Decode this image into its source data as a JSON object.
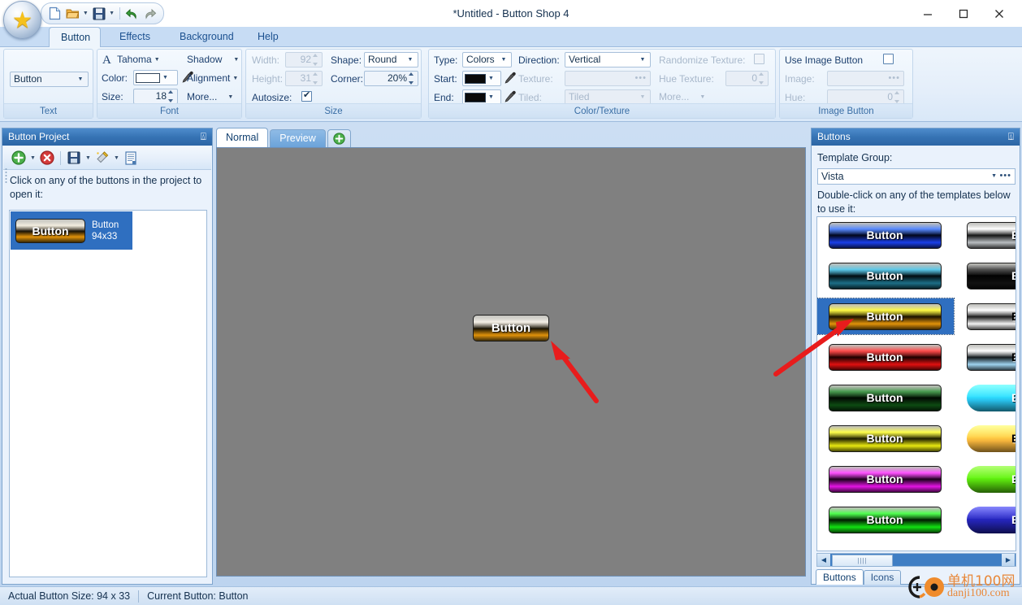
{
  "window": {
    "title": "*Untitled - Button Shop 4",
    "minimize_label": "Minimize",
    "maximize_label": "Maximize",
    "close_label": "Close"
  },
  "quick_access": {
    "items": [
      {
        "icon": "new-document-icon",
        "label": "New"
      },
      {
        "icon": "open-folder-icon",
        "label": "Open"
      },
      {
        "icon": "save-disk-icon",
        "label": "Save"
      },
      {
        "icon": "undo-icon",
        "label": "Undo"
      },
      {
        "icon": "redo-icon",
        "label": "Redo"
      }
    ]
  },
  "app_orb": {
    "icon": "star-icon"
  },
  "ribbon": {
    "tabs": [
      {
        "label": "Button",
        "active": true
      },
      {
        "label": "Effects",
        "active": false
      },
      {
        "label": "Background",
        "active": false
      },
      {
        "label": "Help",
        "active": false
      }
    ],
    "groups": {
      "text": {
        "title": "Text",
        "value": "Button"
      },
      "font": {
        "title": "Font",
        "font_name": "Tahoma",
        "color_label": "Color:",
        "size_label": "Size:",
        "size_value": "18",
        "shadow_label": "Shadow",
        "alignment_label": "Alignment",
        "more_label": "More...",
        "color_value": "#ffffff"
      },
      "size": {
        "title": "Size",
        "width_label": "Width:",
        "width_value": "92",
        "height_label": "Height:",
        "height_value": "31",
        "autosize_label": "Autosize:",
        "autosize_checked": true,
        "shape_label": "Shape:",
        "shape_value": "Round",
        "corner_label": "Corner:",
        "corner_value": "20%"
      },
      "color_texture": {
        "title": "Color/Texture",
        "type_label": "Type:",
        "type_value": "Colors",
        "start_label": "Start:",
        "start_color": "#0a0a0a",
        "end_label": "End:",
        "end_color": "#0a0a0a",
        "direction_label": "Direction:",
        "direction_value": "Vertical",
        "texture_label": "Texture:",
        "texture_value": "",
        "tiled_label": "Tiled:",
        "tiled_value": "Tiled",
        "randomize_label": "Randomize Texture:",
        "randomize_checked": false,
        "hue_texture_label": "Hue Texture:",
        "hue_texture_value": "0",
        "more_label": "More..."
      },
      "image_button": {
        "title": "Image Button",
        "use_label": "Use Image Button",
        "use_checked": false,
        "image_label": "Image:",
        "image_value": "",
        "hue_label": "Hue:",
        "hue_value": "0"
      }
    }
  },
  "left_panel": {
    "title": "Button Project",
    "pin_icon": "pin-icon",
    "toolbar": [
      {
        "icon": "add-button-icon",
        "label": "Add Button",
        "caret": true
      },
      {
        "icon": "delete-button-icon",
        "label": "Delete Button",
        "caret": false
      },
      {
        "icon": "save-project-icon",
        "label": "Save Project",
        "caret": true
      },
      {
        "icon": "wand-icon",
        "label": "Tools",
        "caret": true
      },
      {
        "icon": "list-icon",
        "label": "Properties",
        "caret": false
      }
    ],
    "hint": "Click on any of the buttons in the project to open it:",
    "items": [
      {
        "caption_line1": "Button",
        "caption_line2": "94x33",
        "text": "Button",
        "selected": true
      }
    ]
  },
  "center": {
    "tabs": [
      {
        "label": "Normal",
        "active": true
      },
      {
        "label": "Preview",
        "active": false
      },
      {
        "label": "",
        "icon": "add-tab-icon",
        "active": false
      }
    ],
    "canvas_color": "#808080",
    "button": {
      "text": "Button",
      "width": 94,
      "height": 33
    }
  },
  "right_panel": {
    "title": "Buttons",
    "pin_icon": "pin-icon",
    "template_group_label": "Template Group:",
    "template_group_value": "Vista",
    "hint": "Double-click on any of the templates below to use it:",
    "templates": [
      {
        "text": "Button",
        "accent": "#1a3fe8",
        "shape": "round",
        "dark_text": false,
        "selected": false
      },
      {
        "text": "Butt",
        "accent": "#b9bdc1",
        "shape": "round",
        "dark_text": false,
        "selected": false
      },
      {
        "text": "Button",
        "accent": "#1c6e86",
        "shape": "round",
        "dark_text": false,
        "selected": false
      },
      {
        "text": "Butt",
        "accent": "#111111",
        "shape": "round",
        "dark_text": false,
        "selected": false
      },
      {
        "text": "Button",
        "accent": "#e0920a",
        "shape": "round",
        "dark_text": false,
        "selected": true
      },
      {
        "text": "Butt",
        "accent": "#f2f2f2",
        "shape": "round",
        "dark_text": true,
        "selected": false
      },
      {
        "text": "Button",
        "accent": "#e01010",
        "shape": "round",
        "dark_text": false,
        "selected": false
      },
      {
        "text": "Butt",
        "accent": "#9ed2ee",
        "shape": "round",
        "dark_text": true,
        "selected": false
      },
      {
        "text": "Button",
        "accent": "#0d4a12",
        "shape": "round",
        "dark_text": false,
        "selected": false
      },
      {
        "text": "Butt",
        "accent": "#29c3ee",
        "shape": "pill",
        "dark_text": false,
        "selected": false
      },
      {
        "text": "Button",
        "accent": "#e8e810",
        "shape": "round",
        "dark_text": false,
        "selected": false
      },
      {
        "text": "Butt",
        "accent": "#f5b43c",
        "shape": "pill",
        "dark_text": true,
        "selected": false
      },
      {
        "text": "Button",
        "accent": "#e214e2",
        "shape": "round",
        "dark_text": false,
        "selected": false
      },
      {
        "text": "Butt",
        "accent": "#55d40d",
        "shape": "pill",
        "dark_text": false,
        "selected": false
      },
      {
        "text": "Button",
        "accent": "#12e012",
        "shape": "round",
        "dark_text": false,
        "selected": false
      },
      {
        "text": "Butt",
        "accent": "#2222aa",
        "shape": "pill",
        "dark_text": false,
        "selected": false
      }
    ],
    "scroll": {
      "left_arrow": "◀",
      "right_arrow": "▶"
    },
    "tabs": [
      {
        "label": "Buttons",
        "active": true
      },
      {
        "label": "Icons",
        "active": false
      }
    ]
  },
  "status_bar": {
    "actual_size_label": "Actual Button Size:",
    "actual_size_value": "94 x 33",
    "current_button_label": "Current Button:",
    "current_button_value": "Button"
  },
  "watermark": {
    "line1": "单机100网",
    "line2": "danji100.com",
    "color": "#e8883a"
  }
}
